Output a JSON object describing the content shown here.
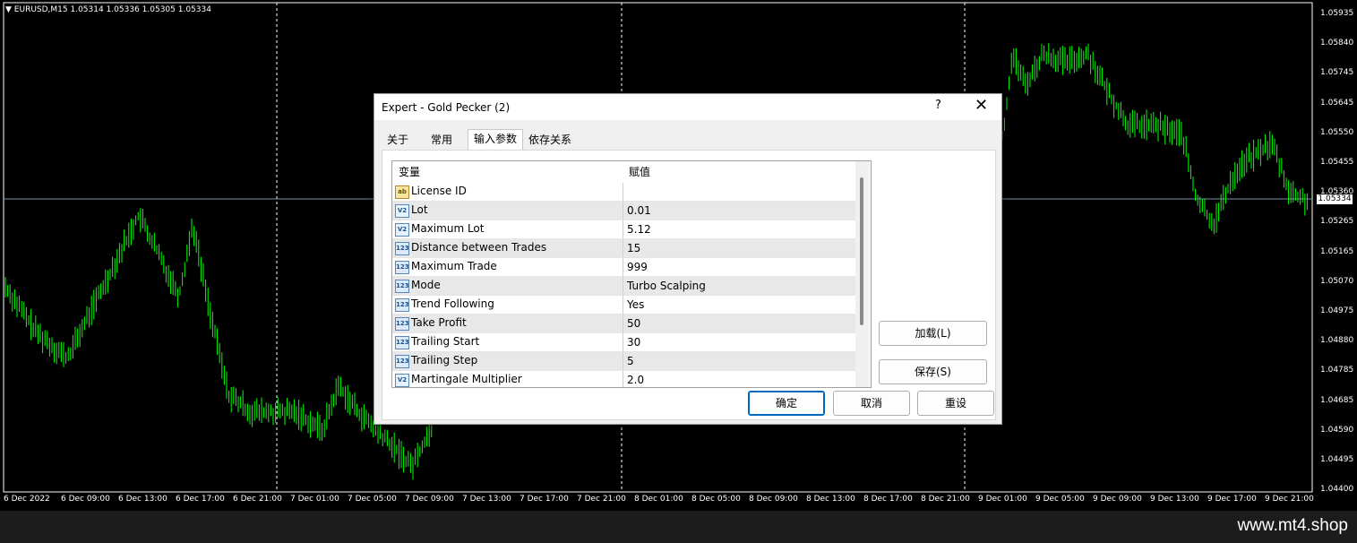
{
  "chart": {
    "symbol_header": "EURUSD,M15  1.05314 1.05336 1.05305 1.05334",
    "current_price": "1.05334",
    "price_ticks": [
      "1.05935",
      "1.05840",
      "1.05745",
      "1.05645",
      "1.05550",
      "1.05455",
      "1.05360",
      "1.05265",
      "1.05165",
      "1.05070",
      "1.04975",
      "1.04880",
      "1.04785",
      "1.04685",
      "1.04590",
      "1.04495",
      "1.04400"
    ],
    "time_ticks": [
      "6 Dec 2022",
      "6 Dec 09:00",
      "6 Dec 13:00",
      "6 Dec 17:00",
      "6 Dec 21:00",
      "7 Dec 01:00",
      "7 Dec 05:00",
      "7 Dec 09:00",
      "7 Dec 13:00",
      "7 Dec 17:00",
      "7 Dec 21:00",
      "8 Dec 01:00",
      "8 Dec 05:00",
      "8 Dec 09:00",
      "8 Dec 13:00",
      "8 Dec 17:00",
      "8 Dec 21:00",
      "9 Dec 01:00",
      "9 Dec 05:00",
      "9 Dec 09:00",
      "9 Dec 13:00",
      "9 Dec 17:00",
      "9 Dec 21:00"
    ],
    "candle_color": "#00ff00",
    "background": "#000000"
  },
  "footer": {
    "text": "www.mt4.shop"
  },
  "dialog": {
    "title": "Expert - Gold Pecker (2)",
    "help_label": "?",
    "close_label": "✕",
    "tabs": [
      {
        "label": "关于"
      },
      {
        "label": "常用"
      },
      {
        "label": "输入参数"
      },
      {
        "label": "依存关系"
      }
    ],
    "active_tab": "输入参数",
    "grid": {
      "col_variable": "变量",
      "col_value": "赋值",
      "rows": [
        {
          "icon": "ab",
          "name": "License ID",
          "value": ""
        },
        {
          "icon": "V2",
          "name": "Lot",
          "value": "0.01"
        },
        {
          "icon": "V2",
          "name": "Maximum Lot",
          "value": "5.12"
        },
        {
          "icon": "123",
          "name": "Distance between Trades",
          "value": "15"
        },
        {
          "icon": "123",
          "name": "Maximum Trade",
          "value": "999"
        },
        {
          "icon": "123",
          "name": "Mode",
          "value": "Turbo Scalping"
        },
        {
          "icon": "123",
          "name": "Trend Following",
          "value": "Yes"
        },
        {
          "icon": "123",
          "name": "Take Profit",
          "value": "50"
        },
        {
          "icon": "123",
          "name": "Trailing Start",
          "value": "30"
        },
        {
          "icon": "123",
          "name": "Trailing Step",
          "value": "5"
        },
        {
          "icon": "V2",
          "name": "Martingale Multiplier",
          "value": "2.0"
        }
      ]
    },
    "load_button": "加载(L)",
    "save_button": "保存(S)",
    "ok_button": "确定",
    "cancel_button": "取消",
    "reset_button": "重设"
  }
}
